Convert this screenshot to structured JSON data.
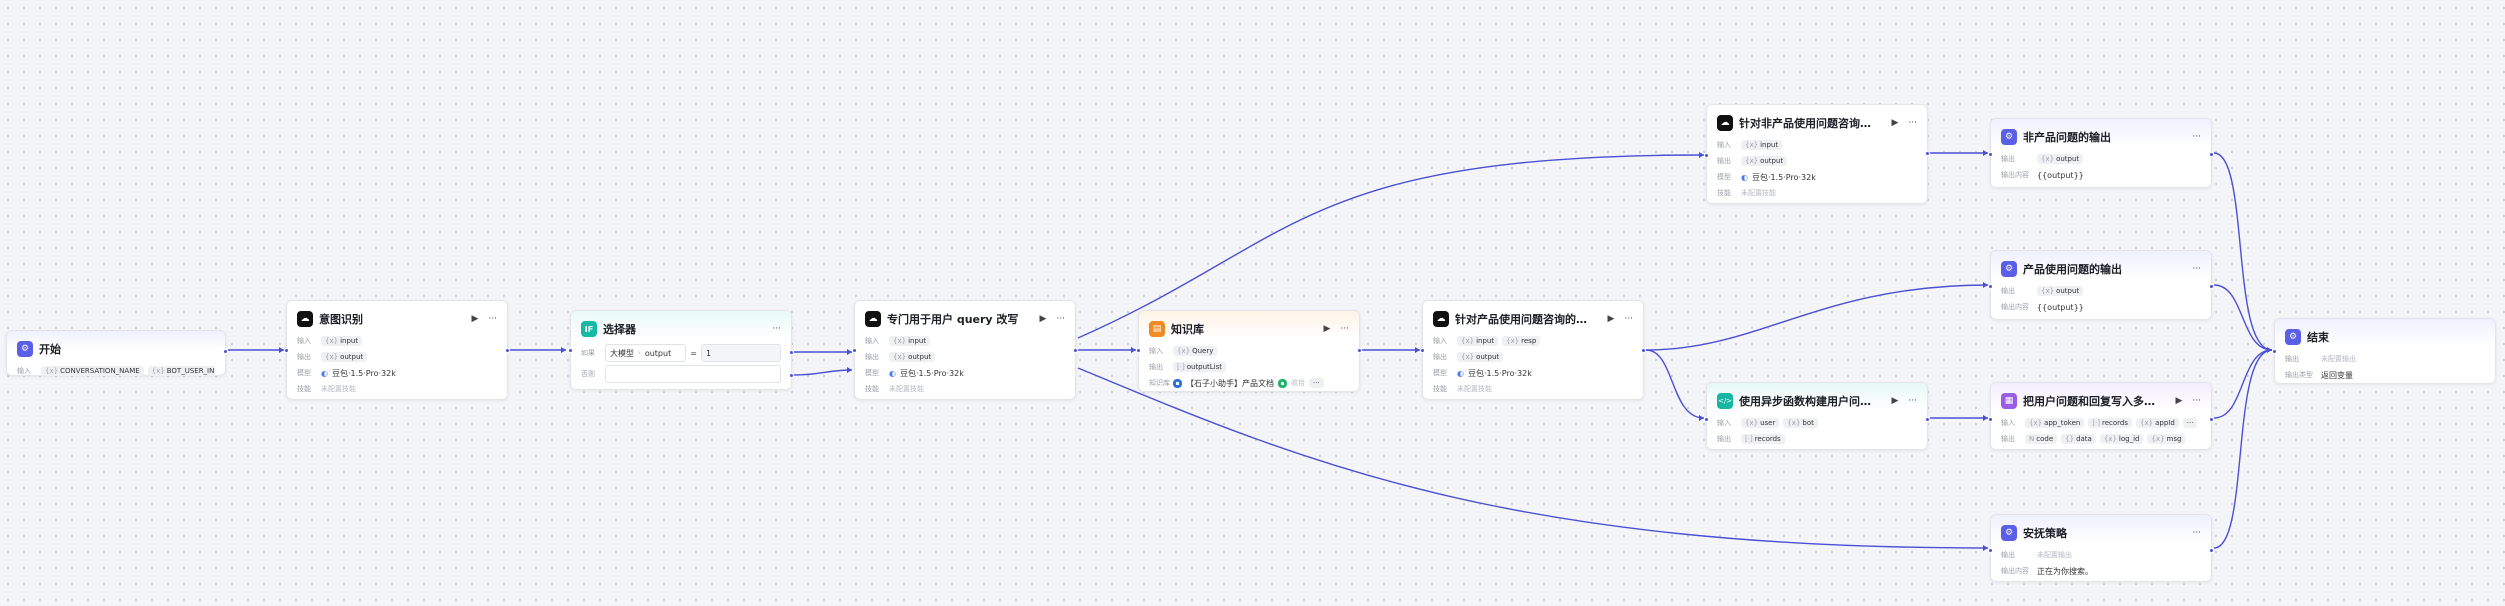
{
  "colors": {
    "edge": "#4b50d6",
    "background": "#f4f5f8"
  },
  "labels": {
    "input": "输入",
    "output": "输出",
    "model": "模型",
    "skill": "技能",
    "knowledge": "知识库",
    "condition": "如果",
    "else": "否则",
    "output_content": "输出内容"
  },
  "start": {
    "title": "开始",
    "icon": "flow-icon",
    "inputs": [
      "CONVERSATION_NAME",
      "BOT_USER_INPUT"
    ]
  },
  "intent": {
    "title": "意图识别",
    "icon": "llm-icon",
    "input": "input",
    "output": "output",
    "model": "豆包·1.5·Pro·32k",
    "skill": "未配置技能"
  },
  "selector": {
    "title": "选择器",
    "icon": "if-icon",
    "left": "大模型",
    "var": "output",
    "op": "=",
    "value": "1"
  },
  "rewrite": {
    "title": "专门用于用户 query 改写",
    "icon": "llm-icon",
    "input": "input",
    "output": "output",
    "model": "豆包·1.5·Pro·32k",
    "skill": "未配置技能"
  },
  "kb": {
    "title": "知识库",
    "icon": "kb-icon",
    "input": "Query",
    "output": "outputList",
    "doc": "【石子小助手】产品文档",
    "doc2": "收拾",
    "more": "···"
  },
  "product_assistant": {
    "title": "针对产品使用问题咨询的小助手...",
    "icon": "llm-icon",
    "inputs": [
      "input",
      "resp"
    ],
    "output": "output",
    "model": "豆包·1.5·Pro·32k",
    "skill": "未配置技能"
  },
  "general_assistant": {
    "title": "针对非产品使用问题咨询的通用...",
    "icon": "llm-icon",
    "input": "input",
    "output": "output",
    "model": "豆包·1.5·Pro·32k",
    "skill": "未配置技能"
  },
  "async_code": {
    "title": "使用异步函数构建用户问题和回...",
    "icon": "code-icon",
    "inputs": [
      "user",
      "bot"
    ],
    "output": "records"
  },
  "non_product_out": {
    "title": "非产品问题的输出",
    "icon": "flow-icon",
    "output": "output",
    "content": "{{output}}"
  },
  "product_out": {
    "title": "产品使用问题的输出",
    "icon": "flow-icon",
    "output": "output",
    "content": "{{output}}"
  },
  "sheet_write": {
    "title": "把用户问题和回复写入多维表格",
    "icon": "plugin-icon",
    "inputs": [
      "app_token",
      "records",
      "appId"
    ],
    "outputs": [
      "code",
      "data",
      "log_id",
      "msg"
    ],
    "more": "···"
  },
  "comfort": {
    "title": "安抚策略",
    "icon": "flow-icon",
    "output": "未配置输出",
    "content": "正在为你搜索。"
  },
  "end": {
    "title": "结束",
    "icon": "flow-icon",
    "output": "未配置输出",
    "var_label": "输出类型",
    "var_value": "返回变量"
  }
}
